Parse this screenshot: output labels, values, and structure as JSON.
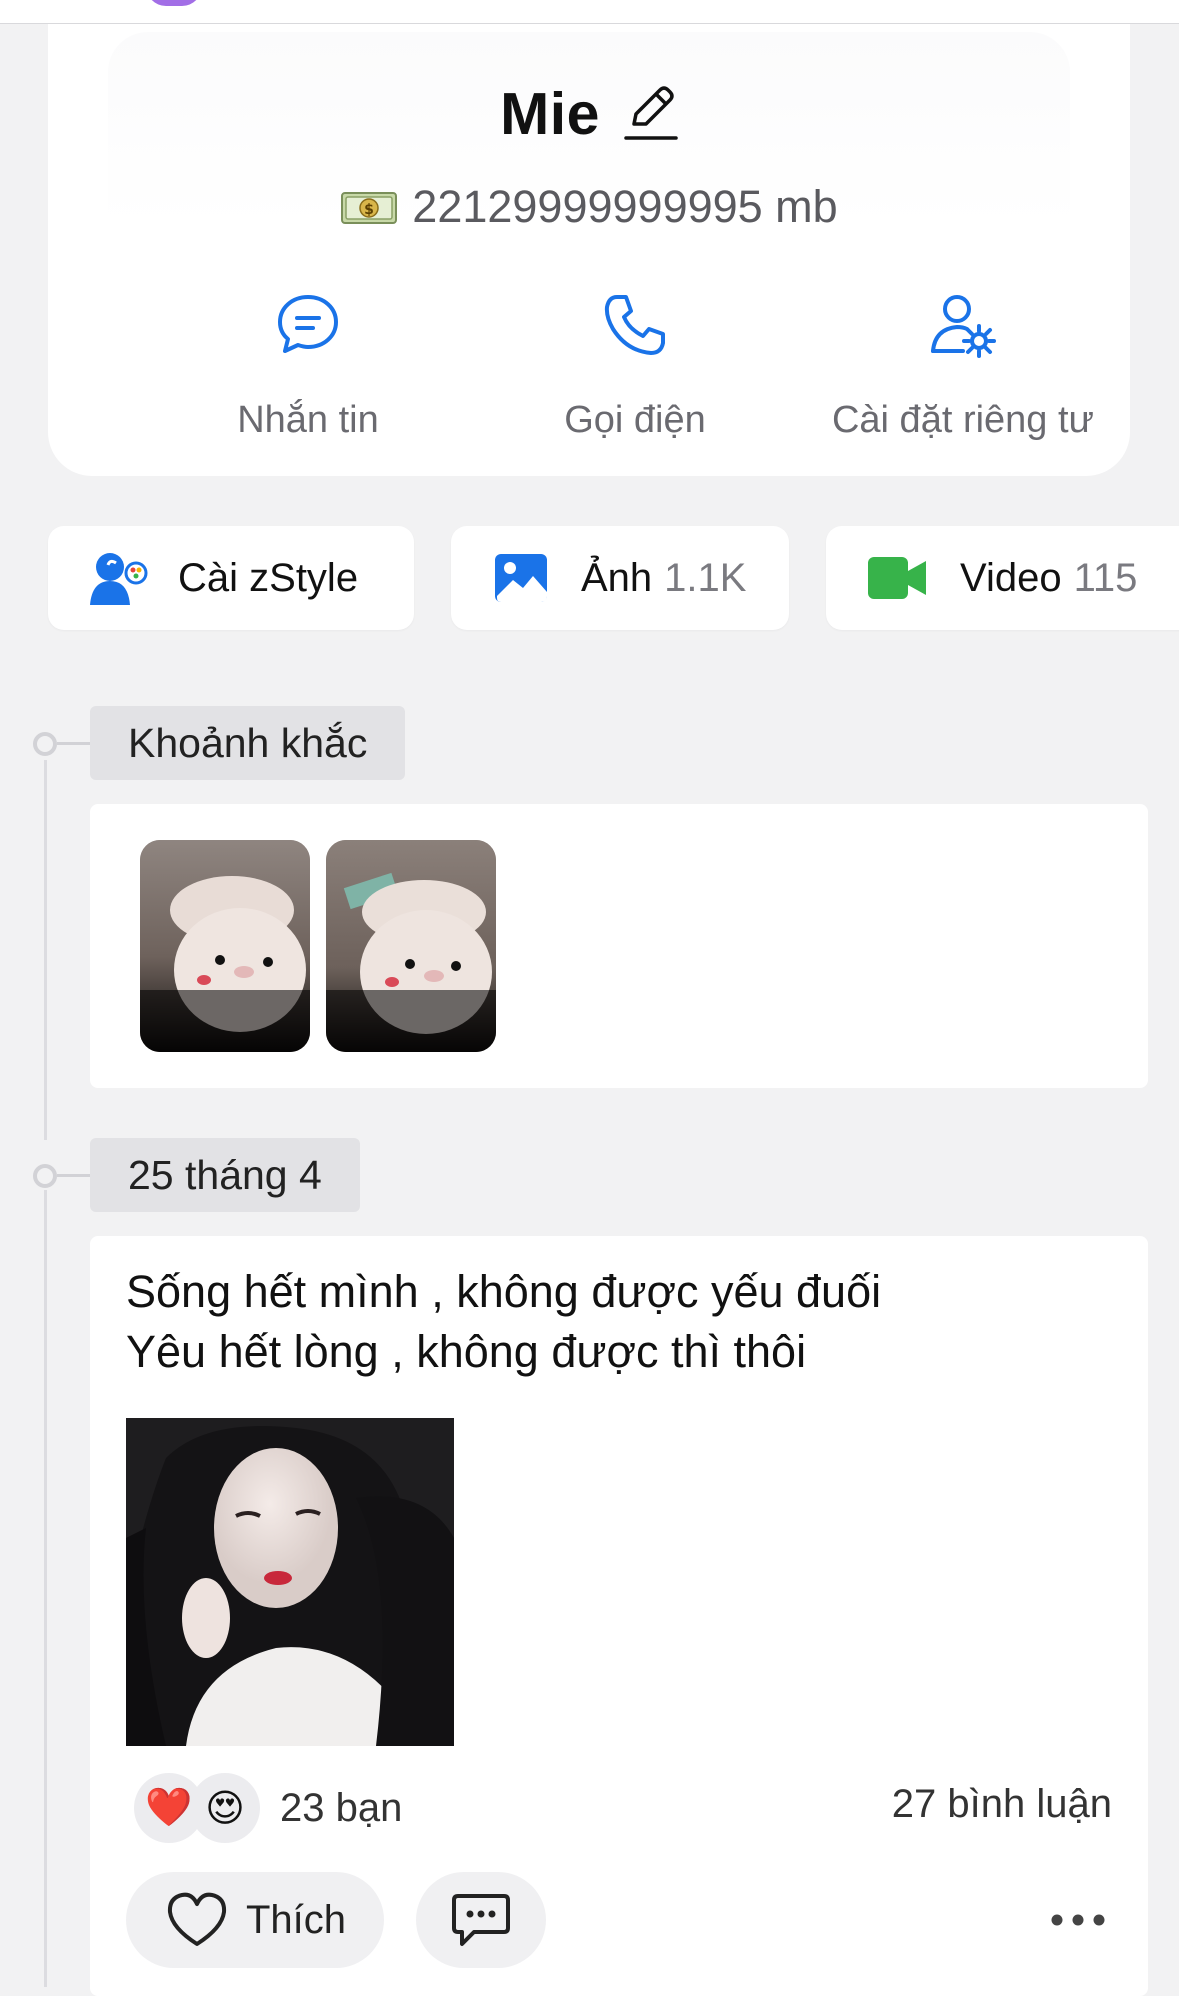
{
  "profile": {
    "name": "Mie",
    "balance": "22129999999995 mb",
    "actions": [
      {
        "label": "Nhắn tin",
        "icon": "chat-bubble-icon"
      },
      {
        "label": "Gọi điện",
        "icon": "phone-icon"
      },
      {
        "label": "Cài đặt riêng tư",
        "icon": "user-settings-icon"
      }
    ]
  },
  "shortcuts": [
    {
      "label": "Cài zStyle",
      "count": "",
      "icon": "zstyle-icon"
    },
    {
      "label": "Ảnh",
      "count": "1.1K",
      "icon": "image-icon"
    },
    {
      "label": "Video",
      "count": "115",
      "icon": "video-camera-icon"
    }
  ],
  "timeline": {
    "moments_label": "Khoảnh khắc",
    "date_label": "25 tháng 4"
  },
  "post": {
    "lines": [
      "Sống hết mình , không được yếu đuối",
      "Yêu hết lòng , không được thì thôi"
    ],
    "reaction_count": "23 bạn",
    "comment_count": "27 bình luận",
    "like_label": "Thích",
    "reaction_emojis": [
      "❤️",
      "😍"
    ]
  },
  "colors": {
    "accent_blue": "#1a73e8",
    "video_green": "#37b34a",
    "background": "#f2f2f3"
  }
}
